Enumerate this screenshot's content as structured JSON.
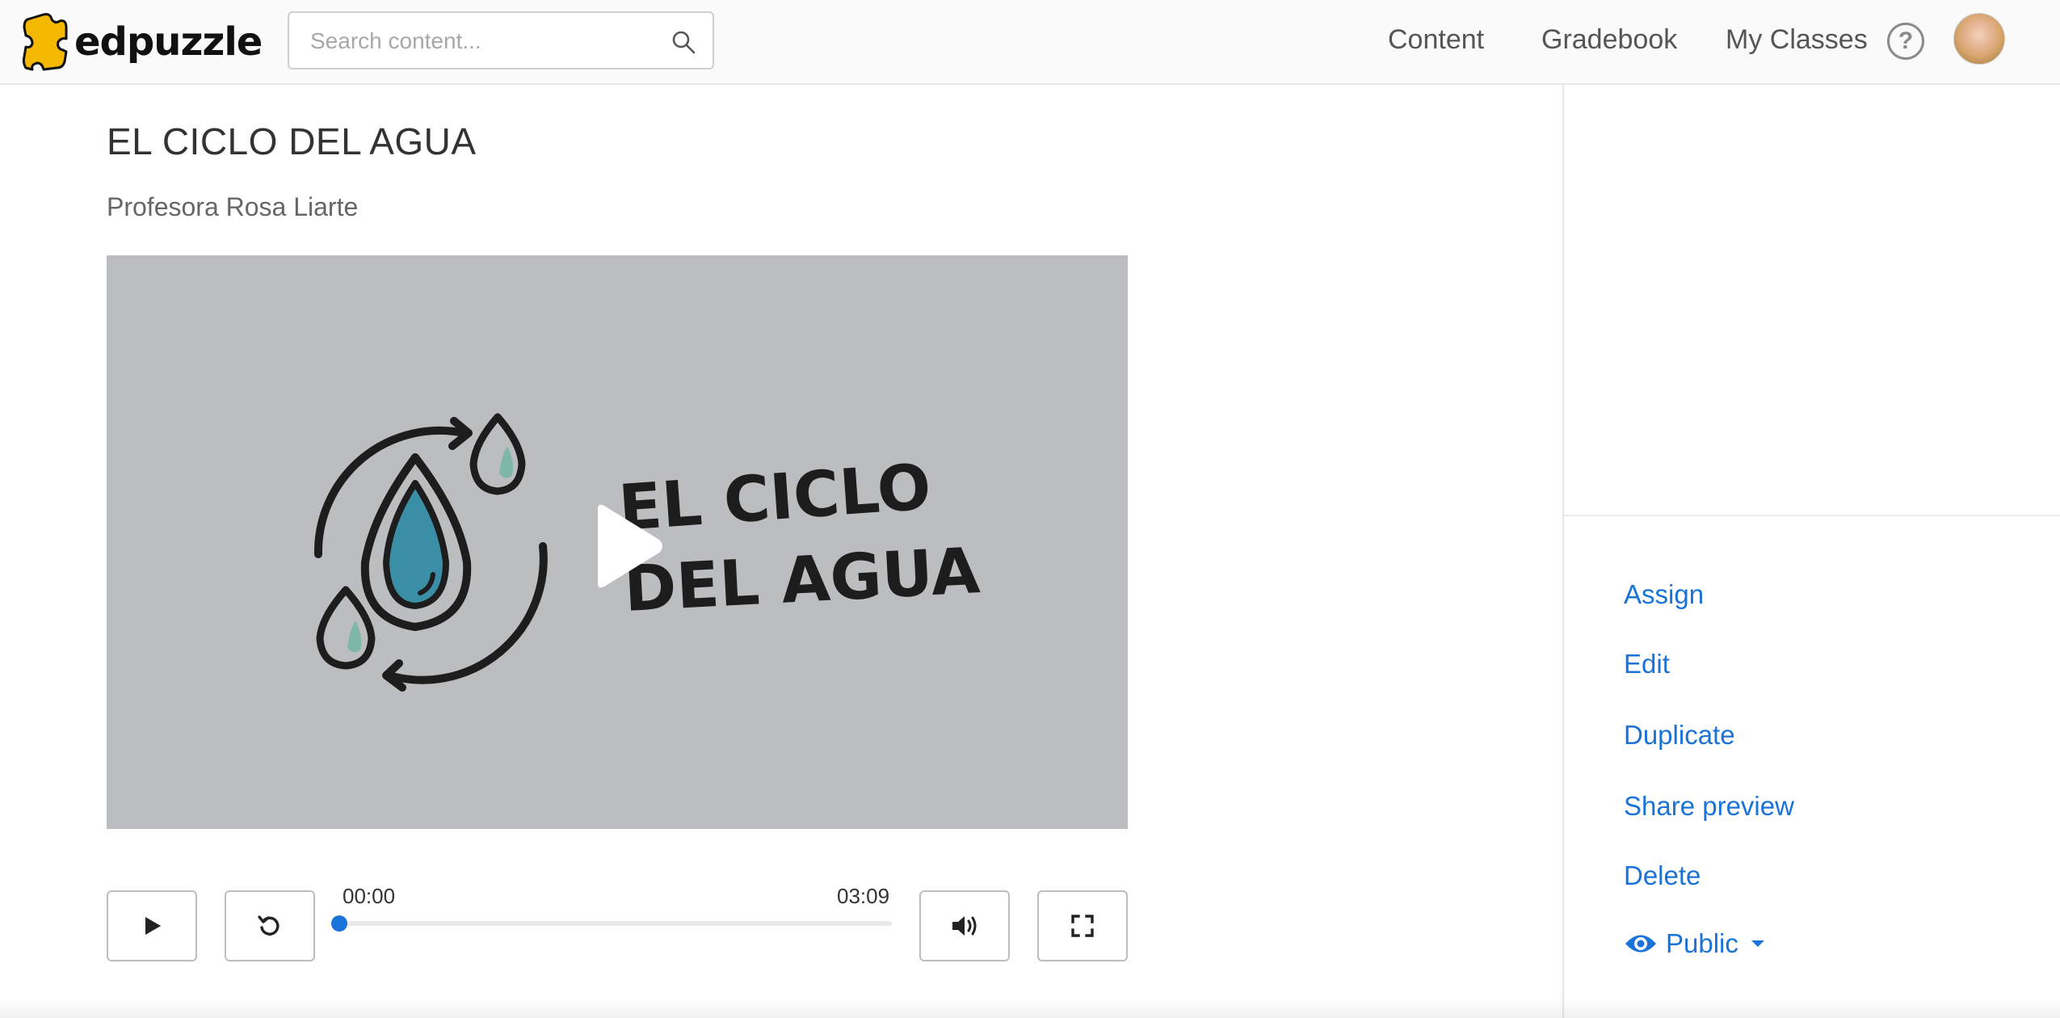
{
  "app": {
    "brand": "edpuzzle",
    "logo_icon": "puzzle-piece-icon",
    "accent_color": "#1a73d9",
    "logo_color": "#f5b800"
  },
  "search": {
    "placeholder": "Search content...",
    "value": "",
    "icon": "search-icon"
  },
  "nav": {
    "content": "Content",
    "gradebook": "Gradebook",
    "my_classes": "My Classes",
    "help_icon": "question-circle-icon",
    "help_glyph": "?"
  },
  "video": {
    "title": "EL CICLO DEL AGUA",
    "author": "Profesora Rosa Liarte",
    "thumbnail_text_line1": "EL CICLO",
    "thumbnail_text_line2": "DEL AGUA",
    "current_time": "00:00",
    "total_time": "03:09",
    "progress": 0,
    "controls": {
      "play": "play-icon",
      "replay": "replay-icon",
      "volume": "volume-icon",
      "fullscreen": "fullscreen-icon"
    }
  },
  "sidebar": {
    "actions": [
      "Assign",
      "Edit",
      "Duplicate",
      "Share preview",
      "Delete"
    ],
    "visibility": {
      "label": "Public",
      "icon": "eye-icon",
      "dropdown_icon": "caret-down-icon"
    }
  }
}
